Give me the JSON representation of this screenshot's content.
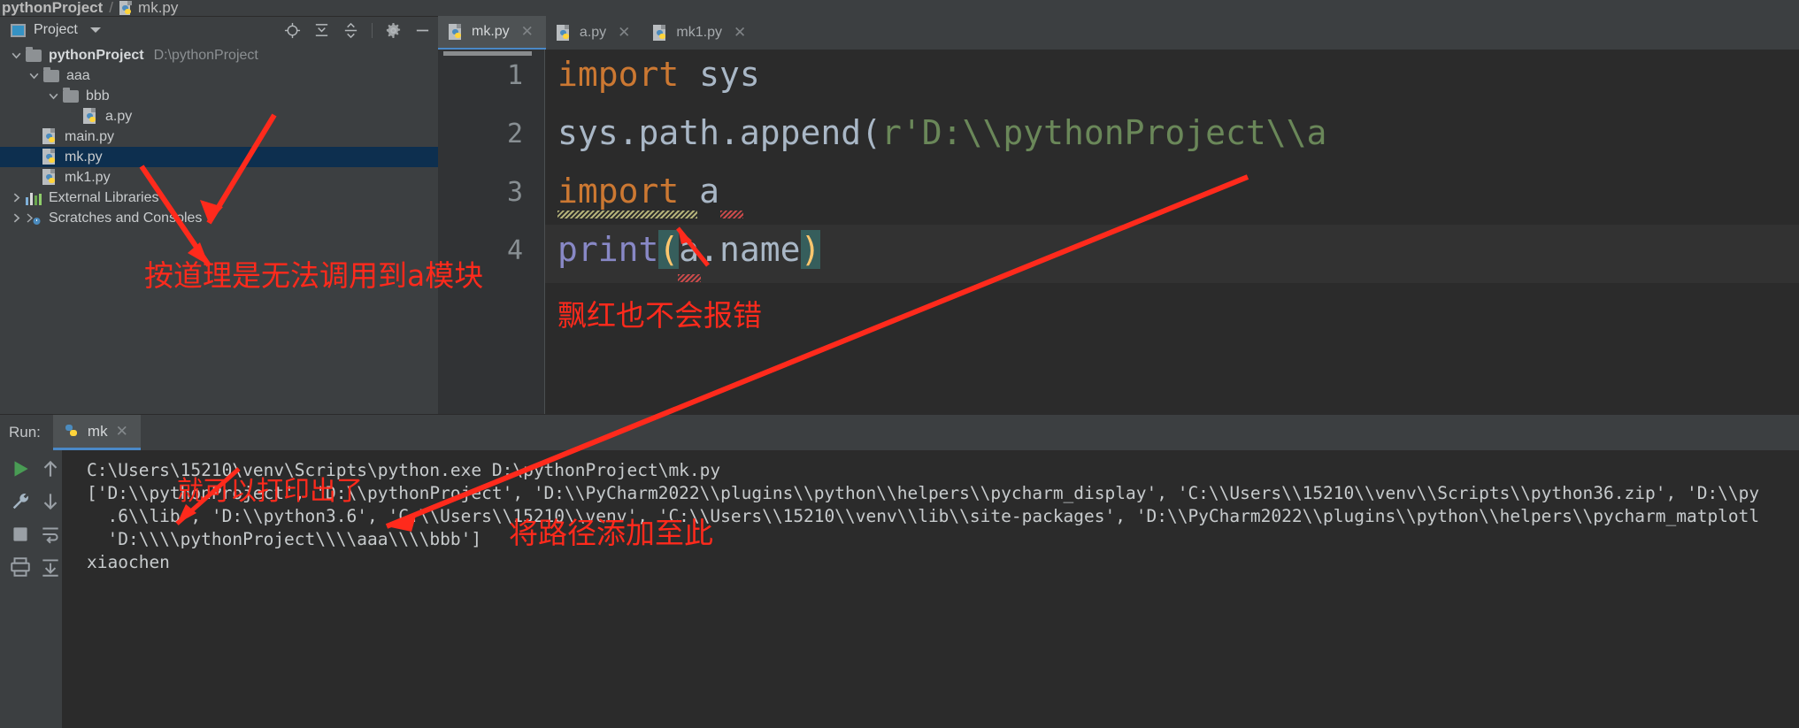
{
  "breadcrumb": {
    "project": "pythonProject",
    "separator": "/",
    "file": "mk.py"
  },
  "sidebar": {
    "title": "Project",
    "caret_icon": "chevron-down-icon",
    "header_icons": [
      "locate-icon",
      "expand-all-icon",
      "collapse-all-icon",
      "settings-gear-icon",
      "hide-icon"
    ],
    "tree": [
      {
        "label": "pythonProject",
        "detail": "D:\\pythonProject",
        "type": "folder",
        "depth": 0,
        "expanded": true,
        "bold": true
      },
      {
        "label": "aaa",
        "detail": "",
        "type": "folder",
        "depth": 1,
        "expanded": true,
        "bold": false
      },
      {
        "label": "bbb",
        "detail": "",
        "type": "folder",
        "depth": 2,
        "expanded": true,
        "bold": false
      },
      {
        "label": "a.py",
        "detail": "",
        "type": "python",
        "depth": 3,
        "expanded": false,
        "bold": false
      },
      {
        "label": "main.py",
        "detail": "",
        "type": "python",
        "depth": 1,
        "expanded": false,
        "bold": false
      },
      {
        "label": "mk.py",
        "detail": "",
        "type": "python",
        "depth": 1,
        "expanded": false,
        "bold": false,
        "selected": true
      },
      {
        "label": "mk1.py",
        "detail": "",
        "type": "python",
        "depth": 1,
        "expanded": false,
        "bold": false
      },
      {
        "label": "External Libraries",
        "detail": "",
        "type": "library",
        "depth": 0,
        "expanded": false,
        "bold": false
      },
      {
        "label": "Scratches and Consoles",
        "detail": "",
        "type": "scratch",
        "depth": 0,
        "expanded": false,
        "bold": false
      }
    ]
  },
  "editor": {
    "tabs": [
      {
        "label": "mk.py",
        "active": true,
        "close_icon": "close-icon"
      },
      {
        "label": "a.py",
        "active": false,
        "close_icon": "close-icon"
      },
      {
        "label": "mk1.py",
        "active": false,
        "close_icon": "close-icon"
      }
    ],
    "line_numbers": [
      "1",
      "2",
      "3",
      "4"
    ],
    "code": {
      "l1_kw": "import",
      "l1_rest": " sys",
      "l2_call": "sys.path.append(",
      "l2_str": "r'D:\\\\pythonProject\\\\a",
      "l3_kw": "import",
      "l3_rest": " a",
      "l4_fn": "print",
      "l4_open": "(",
      "l4_arg": "a.name",
      "l4_close": ")"
    }
  },
  "run": {
    "label": "Run:",
    "tab_label": "mk",
    "tab_close_icon": "close-icon",
    "toolbar_icons": [
      "run-icon",
      "step-up-icon",
      "wrench-icon",
      "step-down-icon",
      "stop-icon",
      "soft-wrap-icon",
      "print-icon",
      "scroll-end-icon"
    ],
    "console_lines": [
      "C:\\Users\\15210\\venv\\Scripts\\python.exe D:\\pythonProject\\mk.py",
      "['D:\\\\pythonProject', 'D:\\\\pythonProject', 'D:\\\\PyCharm2022\\\\plugins\\\\python\\\\helpers\\\\pycharm_display', 'C:\\\\Users\\\\15210\\\\venv\\\\Scripts\\\\python36.zip', 'D:\\\\py",
      "  .6\\\\lib', 'D:\\\\python3.6', 'C:\\\\Users\\\\15210\\\\venv', 'C:\\\\Users\\\\15210\\\\venv\\\\lib\\\\site-packages', 'D:\\\\PyCharm2022\\\\plugins\\\\python\\\\helpers\\\\pycharm_matplotl",
      "  'D:\\\\\\\\pythonProject\\\\\\\\aaa\\\\\\\\bbb']",
      "xiaochen"
    ]
  },
  "annotations": [
    {
      "id": "anno-sidebar",
      "text": "按道理是无法调用到a模块"
    },
    {
      "id": "anno-editor",
      "text": "飘红也不会报错"
    },
    {
      "id": "anno-console",
      "text": "就可以打印出了"
    },
    {
      "id": "anno-path",
      "text": "将路径添加至此"
    }
  ],
  "colors": {
    "annotation_red": "#ff2a1c",
    "accent_blue": "#4a88c7",
    "selection_blue": "#0d2f4f",
    "keyword_orange": "#cc7832",
    "string_green": "#6a8759",
    "function_purple": "#8888c6",
    "plain_text": "#a9b7c6"
  }
}
